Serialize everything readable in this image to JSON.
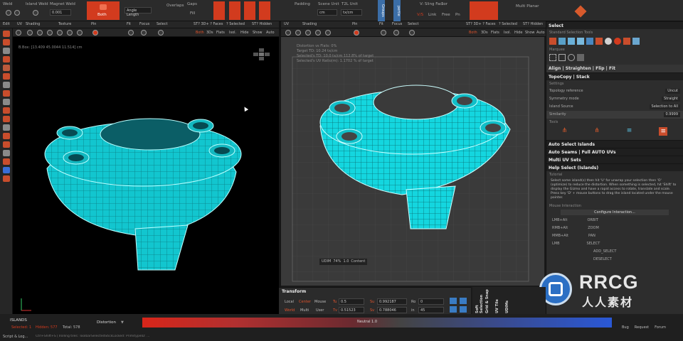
{
  "topbar": {
    "left_labels": [
      "Weld",
      "Island Weld",
      "Magnet Weld",
      "0.001"
    ],
    "bake_label": "Both",
    "angle_label": "Angle Length",
    "overlaps_label": "Overlaps",
    "gaps_label": "Gaps",
    "fill_label": "Fill",
    "padding_label": "Padding",
    "scene_unit_label": "Scene Unit",
    "t2l_unit_label": "T2L Unit",
    "unit_value1": "cm",
    "unit_value2": "tx/cm",
    "groups_label": "Groups",
    "partial_label": "pertie",
    "sling_label": "V: Sling Factor",
    "sling_value": "1",
    "link_label": "Link",
    "free_label": "Free",
    "pin_label": "Pn",
    "vs_label": "V/S",
    "multi_planar_label": "Multi Planar"
  },
  "viewport_toolbar_left": {
    "labels": [
      "Edit",
      "UV",
      "Shading",
      "Texture",
      "Pin",
      "Fit",
      "Focus",
      "Select",
      "ST? 3D+ ? Faces",
      "? Selected",
      "ST? Hidden"
    ],
    "mode_labels": [
      "Both",
      "3Ds",
      "Flats",
      "Isol.",
      "Hide",
      "Show",
      "Auto"
    ]
  },
  "viewport_toolbar_right": {
    "labels": [
      "UV",
      "Shading",
      "Pin",
      "Fit",
      "Focus",
      "Select",
      "ST? 3D+ ? Faces",
      "? Selected",
      "ST? Hidden"
    ],
    "mode_labels": [
      "Both",
      "3Ds",
      "Flats",
      "Isol.",
      "Hide",
      "Show",
      "Auto"
    ]
  },
  "viewport3d": {
    "bbox_text": "B.Box: [13.409 45.0044 11.514] cm"
  },
  "viewportuv": {
    "info_lines": [
      "Distortion vs Flats: 0%",
      "Target TD: 10.24 tx/cm",
      "Selected's TD: 10.0 tx/cm 112.8% of target",
      "Selected's UV Ratio(m): 1.1702 % of target"
    ],
    "zoom_labels": [
      "UDIM",
      "74%",
      "1.0",
      "Content"
    ]
  },
  "right_panel": {
    "select_title": "Select",
    "standard_selection_title": "Standard Selection Tools",
    "marquee_label": "Marquee",
    "align_label": "Align | Straighten | Flip | Fit",
    "topocopy_label": "TopoCopy | Stack",
    "settings_label": "Settings",
    "props": [
      {
        "name": "Topology reference",
        "value": "Uncut"
      },
      {
        "name": "Symmetry mode",
        "value": "Straight"
      },
      {
        "name": "Island Source",
        "value": "Selection to All"
      },
      {
        "name": "Similarity",
        "value": "0.9999"
      }
    ],
    "tools_label": "Tools",
    "auto_select": "Auto Select Islands",
    "auto_seams": "Auto Seams | Full AUTO UVs",
    "multi_uv": "Multi UV Sets",
    "help_select": "Help Select (Islands)",
    "tutorial_label": "Tutorial",
    "help_text": "Select some island(s) then hit 'U' for unwrap your selection then 'O' (optimize) to reduce the distortion. When something is selected, hit 'Shift' to display the Gizmo and have a rapid access to rotate, translate and scale. Press key 'D' + mouse buttons to drag the island located under the mouse pointer.",
    "mouse_label": "Mouse Interaction",
    "configure_label": "Configure Interaction...",
    "bindings": [
      {
        "key": "LMB+Alt",
        "action": "ORBIT"
      },
      {
        "key": "RMB+Alt",
        "action": "ZOOM"
      },
      {
        "key": "MMB+Alt",
        "action": "PAN"
      },
      {
        "key": "LMB",
        "action": "SELECT"
      },
      {
        "key": "",
        "action": "ADD_SELECT"
      },
      {
        "key": "",
        "action": "DESELECT"
      }
    ],
    "bottom_links": [
      "Bug",
      "Request",
      "Forum"
    ]
  },
  "transform": {
    "title": "Transform",
    "local_label": "Local",
    "center_label": "Center",
    "mouse_label": "Mouse",
    "world_label": "World",
    "multi_label": "Multi",
    "user_label": "User",
    "tu_label": "Tu",
    "tu_value": "0.5",
    "tv_label": "Tv",
    "tv_value": "0.51523",
    "su_label": "Su",
    "su_value": "0.992187",
    "sv_label": "Sv",
    "sv_value": "0.788046",
    "ro_label": "Ro",
    "ro_value": "0",
    "in_label": "in",
    "in_value": "45"
  },
  "vertical_tabs": [
    "Soft Selection",
    "Grid & Snap",
    "UV Tile",
    "UDIMs"
  ],
  "status": {
    "islands_label": "ISLANDS",
    "selected_label": "Selected: 1",
    "hidden_label": "Hidden: 577",
    "total_label": "Total: 578",
    "distortion_label": "Distortion",
    "neutral_label": "Neutral 1.0",
    "script_label": "Script & Log...",
    "log_text": "Ctrl+Shift+S [Trolling tiles: ToolbarSelectedStickLocked: PrimitypeID: ..."
  },
  "watermark": {
    "brand": "RRCG",
    "subtitle": "人人素材"
  },
  "colors": {
    "accent_red": "#d23b1e",
    "mesh_cyan": "#19e6ee",
    "panel_bg": "#2d2d2d"
  }
}
